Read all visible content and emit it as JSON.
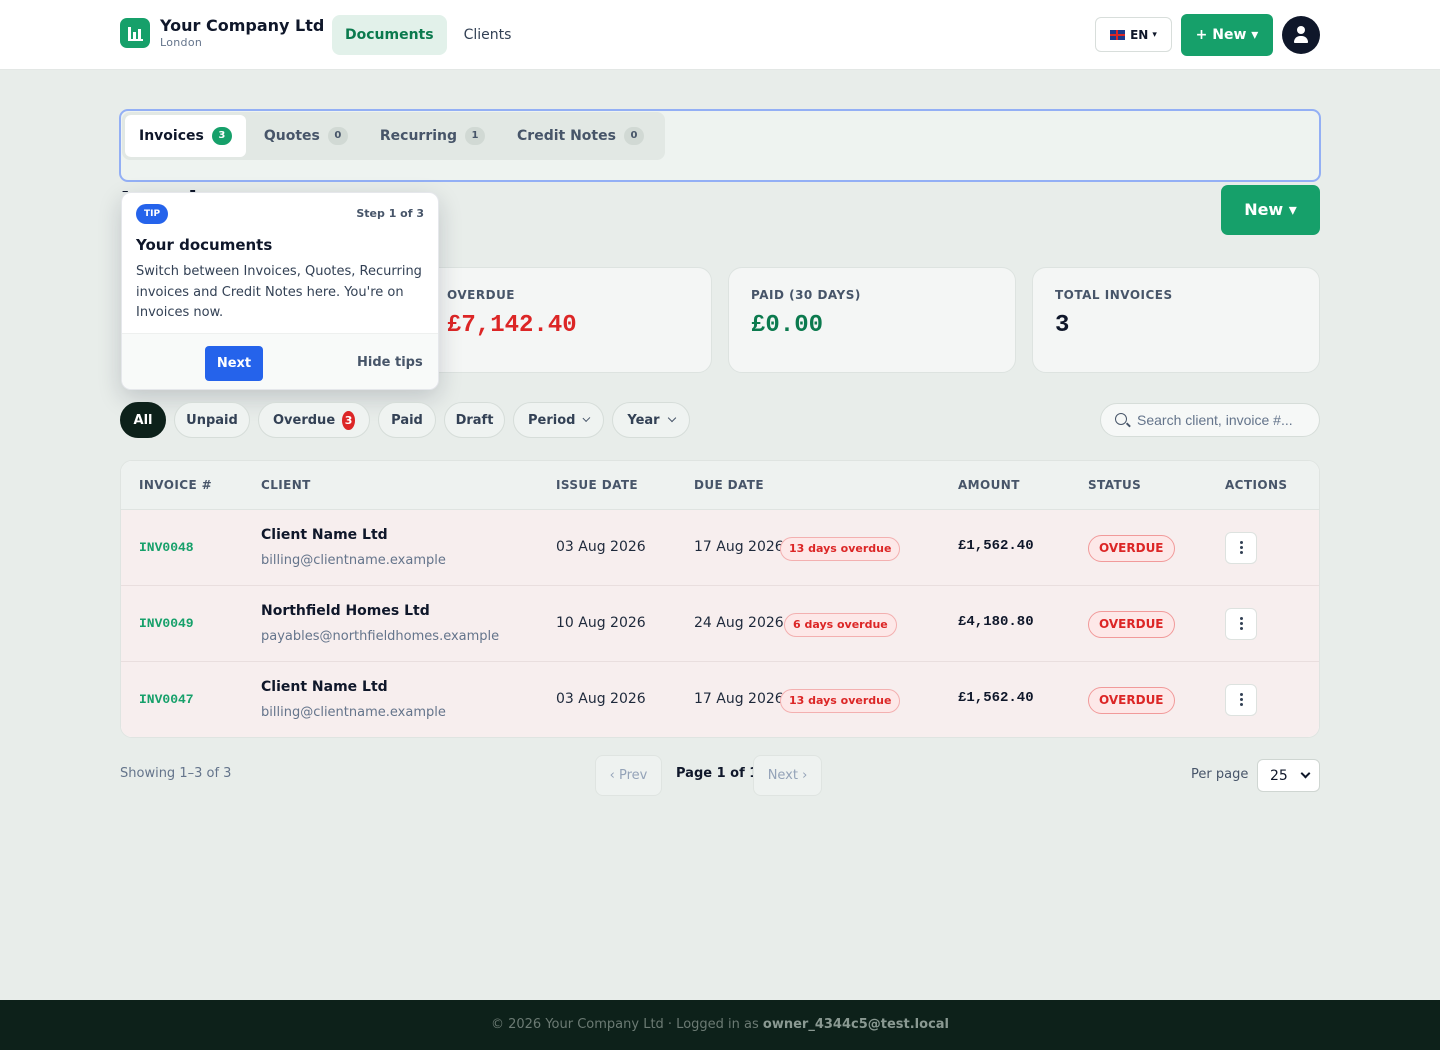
{
  "header": {
    "company_name": "Your Company Ltd",
    "company_city": "London",
    "nav": [
      {
        "label": "Documents",
        "active": true
      },
      {
        "label": "Clients",
        "active": false
      }
    ],
    "language": "EN",
    "new_button": "+ New ▾",
    "brand_color": "#16a06a"
  },
  "tabs": [
    {
      "label": "Invoices",
      "count": "3",
      "active": true
    },
    {
      "label": "Quotes",
      "count": "0"
    },
    {
      "label": "Recurring",
      "count": "1"
    },
    {
      "label": "Credit Notes",
      "count": "0"
    }
  ],
  "page": {
    "title": "Invoices",
    "new_button": "New ▾"
  },
  "stats": [
    {
      "label": "OVERDUE",
      "value": "£7,142.40",
      "color": "#dc2626"
    },
    {
      "label": "PAID (30 DAYS)",
      "value": "£0.00",
      "color": "#0b7a4e"
    },
    {
      "label": "TOTAL INVOICES",
      "value": "3",
      "color": "#0f172a"
    }
  ],
  "tip": {
    "badge": "TIP",
    "step": "Step 1 of 3",
    "title": "Your documents",
    "body": "Switch between Invoices, Quotes, Recurring invoices and Credit Notes here. You're on Invoices now.",
    "next": "Next",
    "hide": "Hide tips"
  },
  "filters": {
    "all": "All",
    "unpaid": "Unpaid",
    "overdue": "Overdue",
    "overdue_count": "3",
    "paid": "Paid",
    "draft": "Draft",
    "period": "Period",
    "year": "Year",
    "search_placeholder": "Search client, invoice #..."
  },
  "table": {
    "headers": [
      "INVOICE #",
      "CLIENT",
      "ISSUE DATE",
      "DUE DATE",
      "AMOUNT",
      "STATUS",
      "ACTIONS"
    ],
    "rows": [
      {
        "invoice": "INV0048",
        "client": "Client Name Ltd",
        "email": "billing@clientname.example",
        "issue_date": "03 Aug 2026",
        "due_date": "17 Aug 2026",
        "overdue_note": "13 days overdue",
        "amount": "£1,562.40",
        "status": "OVERDUE"
      },
      {
        "invoice": "INV0049",
        "client": "Northfield Homes Ltd",
        "email": "payables@northfieldhomes.example",
        "issue_date": "10 Aug 2026",
        "due_date": "24 Aug 2026",
        "overdue_note": "6 days overdue",
        "amount": "£4,180.80",
        "status": "OVERDUE"
      },
      {
        "invoice": "INV0047",
        "client": "Client Name Ltd",
        "email": "billing@clientname.example",
        "issue_date": "03 Aug 2026",
        "due_date": "17 Aug 2026",
        "overdue_note": "13 days overdue",
        "amount": "£1,562.40",
        "status": "OVERDUE"
      }
    ]
  },
  "pagination": {
    "showing": "Showing 1–3 of 3",
    "prev": "‹ Prev",
    "page": "Page 1 of 1",
    "next": "Next ›",
    "per_page_label": "Per page",
    "per_page_value": "25"
  },
  "footer": {
    "text": "© 2026 Your Company Ltd · Logged in as",
    "user": "owner_4344c5@test.local"
  }
}
